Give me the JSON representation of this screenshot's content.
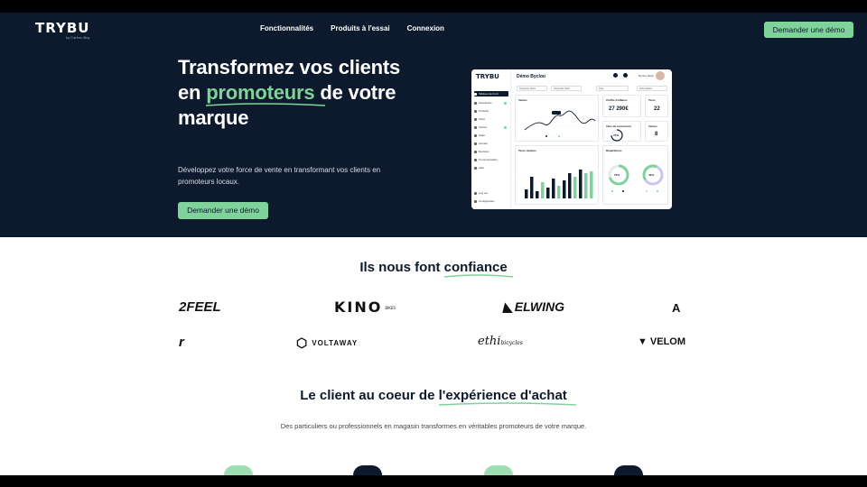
{
  "brand": {
    "name": "TRYBU",
    "tagline": "by Carbon Buy"
  },
  "nav": {
    "links": [
      "Fonctionnalités",
      "Produits à l'essai",
      "Connexion"
    ],
    "cta": "Demander une démo"
  },
  "hero": {
    "title_pre": "Transformez vos clients",
    "title_mid_pre": "en ",
    "title_highlight": "promoteurs",
    "title_mid_post": " de votre",
    "title_post": "marque",
    "description": "Développez votre force de vente en transformant vos clients en promoteurs locaux.",
    "cta": "Demander une démo"
  },
  "dashboard": {
    "logo": "TRYBU",
    "title": "Démo Byclou",
    "user": "Byclou Mock",
    "sidebar": [
      "Tableau de bord",
      "Opérations",
      "Produits",
      "Tests",
      "Ventes",
      "Stats",
      "Accueil",
      "Reviews",
      "Communication",
      "Aide",
      "Log out",
      "Configuration"
    ],
    "filters": [
      "01 janvier 2024",
      "31 janvier 2024",
      "Tous",
      "Informations"
    ],
    "cards": {
      "ventes_label": "Ventes",
      "ca_label": "Chiffre d'affaires",
      "ca_value": "27 290€",
      "tests_label": "Tests",
      "tests_value": "22",
      "conv_label": "Taux de conversion",
      "conv_value": "76%",
      "ventes2_label": "Ventes",
      "ventes2_value": "8",
      "activity_label": "Tests réalisés",
      "repartition_label": "Répartitions",
      "donut1_value": "70%",
      "donut2_value": "40%"
    }
  },
  "trust": {
    "title_pre": "Ils nous font ",
    "title_highlight": "confiance",
    "logos_row1": [
      "2FEEL",
      "KINO",
      "ELWING",
      "A"
    ],
    "logos_row1_sub": "BIKES",
    "logos_row2": [
      "r",
      "VOLTAWAY",
      "ethi",
      "VELOM"
    ],
    "logos_row2_sub": "bicycles"
  },
  "experience": {
    "title_pre": "Le client au coeur de ",
    "title_highlight": "l'expérience d'achat",
    "description": "Des particuliers ou professionnels en magasin transformes en véritables promoteurs de votre marque."
  },
  "colors": {
    "navy": "#0d1a2d",
    "green": "#7fd39a"
  }
}
